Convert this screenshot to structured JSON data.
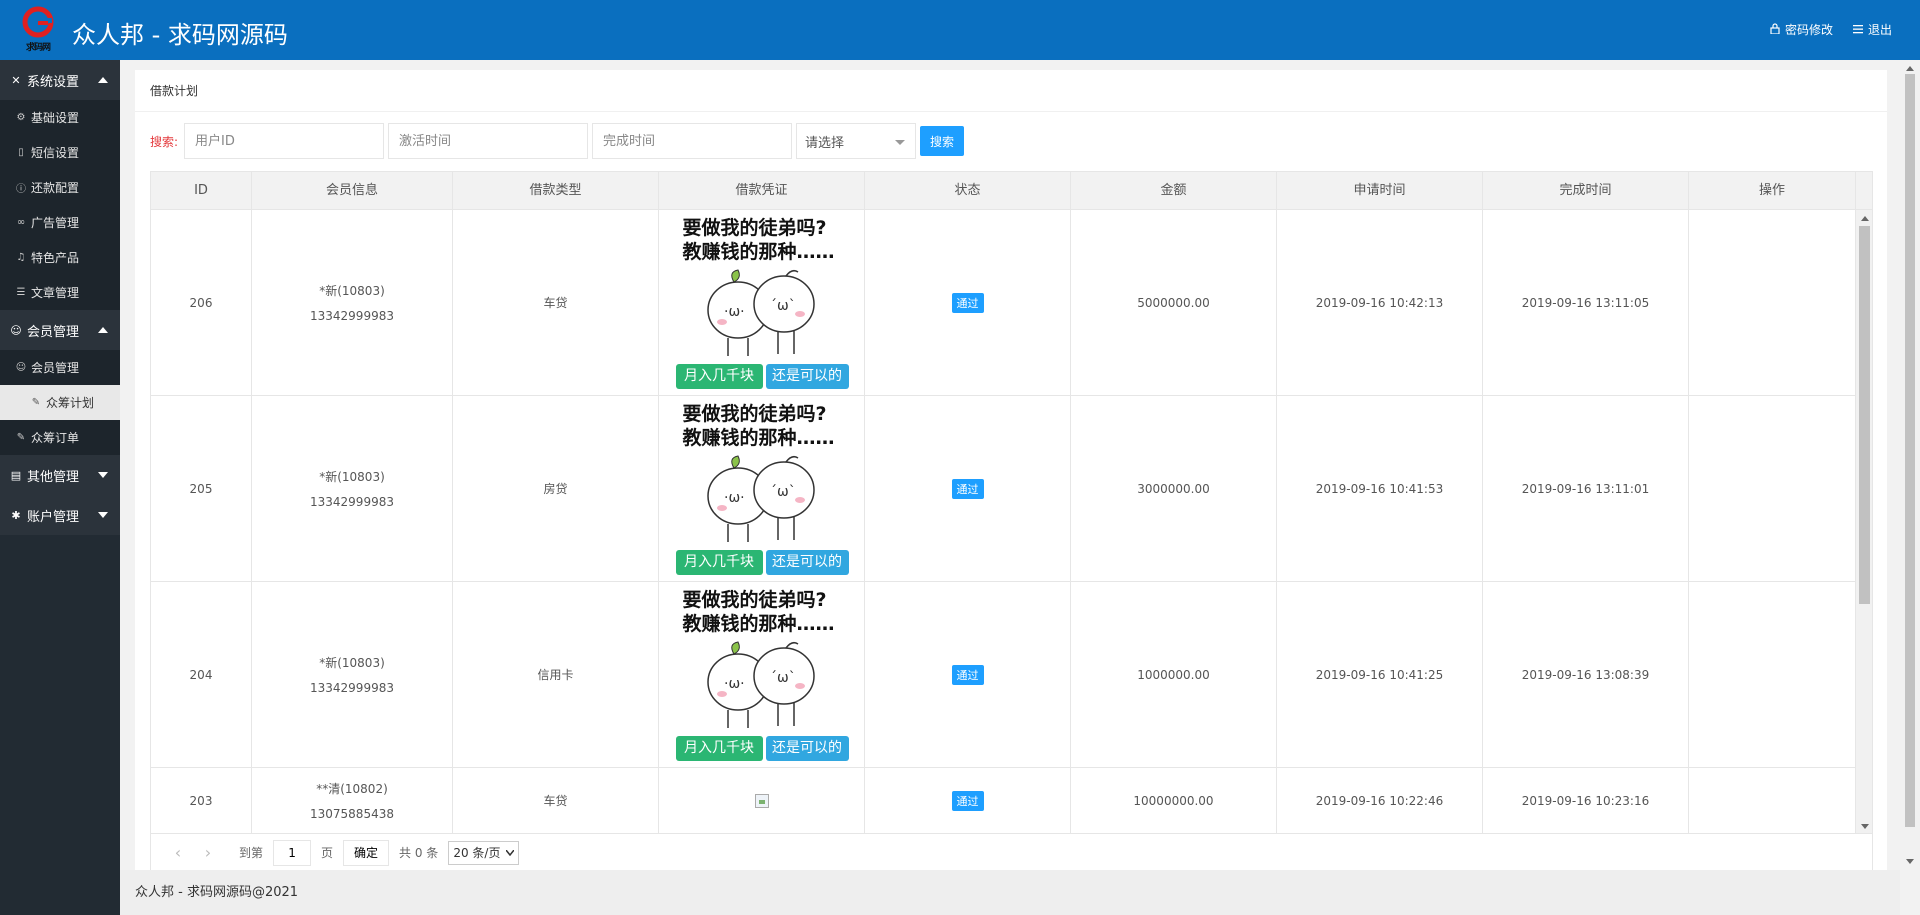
{
  "header": {
    "logo_text": "求码网",
    "title": "众人邦 - 求码网源码",
    "change_password": "密码修改",
    "logout": "退出"
  },
  "sidebar": {
    "groups": [
      {
        "label": "系统设置",
        "icon": "tools-icon",
        "expanded": true,
        "items": [
          {
            "label": "基础设置",
            "icon": "gear-icon"
          },
          {
            "label": "短信设置",
            "icon": "phone-icon"
          },
          {
            "label": "还款配置",
            "icon": "info-circle-icon"
          },
          {
            "label": "广告管理",
            "icon": "link-icon"
          },
          {
            "label": "特色产品",
            "icon": "bell-icon"
          },
          {
            "label": "文章管理",
            "icon": "list-icon"
          }
        ]
      },
      {
        "label": "会员管理",
        "icon": "user-icon",
        "expanded": true,
        "items": [
          {
            "label": "会员管理",
            "icon": "user-icon"
          },
          {
            "label": "众筹计划",
            "icon": "edit-icon",
            "active": true
          },
          {
            "label": "众筹订单",
            "icon": "edit-icon"
          }
        ]
      },
      {
        "label": "其他管理",
        "icon": "doc-icon",
        "expanded": false
      },
      {
        "label": "账户管理",
        "icon": "cog-icon",
        "expanded": false
      }
    ]
  },
  "card": {
    "title": "借款计划"
  },
  "search": {
    "label": "搜索:",
    "user_id_placeholder": "用户ID",
    "activate_time_placeholder": "激活时间",
    "complete_time_placeholder": "完成时间",
    "select_value": "请选择",
    "button": "搜索"
  },
  "table": {
    "columns": [
      "ID",
      "会员信息",
      "借款类型",
      "借款凭证",
      "状态",
      "金额",
      "申请时间",
      "完成时间",
      "操作"
    ],
    "meme": {
      "line1": "要做我的徒弟吗?",
      "line2": "教赚钱的那种……",
      "tag_left": "月入几千块",
      "tag_right": "还是可以的"
    },
    "rows": [
      {
        "id": "206",
        "member_name": "*新(10803)",
        "member_phone": "13342999983",
        "type": "车贷",
        "status": "通过",
        "amount": "5000000.00",
        "apply_time": "2019-09-16 10:42:13",
        "complete_time": "2019-09-16 13:11:05"
      },
      {
        "id": "205",
        "member_name": "*新(10803)",
        "member_phone": "13342999983",
        "type": "房贷",
        "status": "通过",
        "amount": "3000000.00",
        "apply_time": "2019-09-16 10:41:53",
        "complete_time": "2019-09-16 13:11:01"
      },
      {
        "id": "204",
        "member_name": "*新(10803)",
        "member_phone": "13342999983",
        "type": "信用卡",
        "status": "通过",
        "amount": "1000000.00",
        "apply_time": "2019-09-16 10:41:25",
        "complete_time": "2019-09-16 13:08:39"
      },
      {
        "id": "203",
        "member_name": "**清(10802)",
        "member_phone": "13075885438",
        "type": "车贷",
        "status": "通过",
        "amount": "10000000.00",
        "apply_time": "2019-09-16 10:22:46",
        "complete_time": "2019-09-16 10:23:16"
      }
    ]
  },
  "pager": {
    "goto_label": "到第",
    "page_value": "1",
    "page_unit": "页",
    "confirm": "确定",
    "total": "共 0 条",
    "page_size": "20 条/页"
  },
  "footer": {
    "text": "众人邦 - 求码网源码@2021"
  }
}
